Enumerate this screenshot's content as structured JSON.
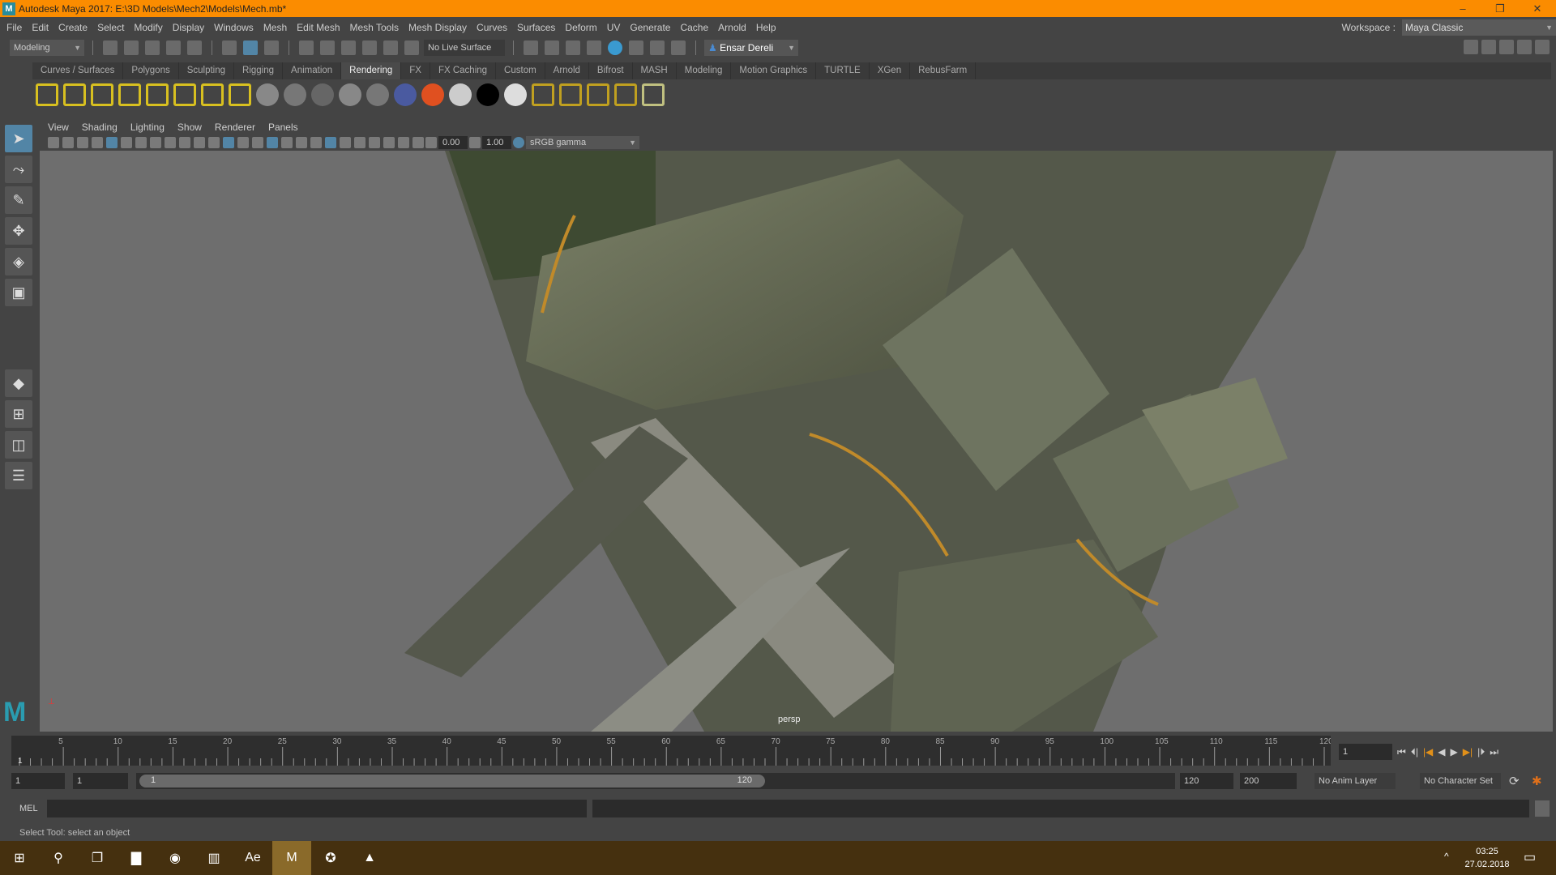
{
  "window": {
    "title": "Autodesk Maya 2017: E:\\3D Models\\Mech2\\Models\\Mech.mb*",
    "logo": "M",
    "minimize": "–",
    "maximize": "❐",
    "close": "✕"
  },
  "menu": [
    "File",
    "Edit",
    "Create",
    "Select",
    "Modify",
    "Display",
    "Windows",
    "Mesh",
    "Edit Mesh",
    "Mesh Tools",
    "Mesh Display",
    "Curves",
    "Surfaces",
    "Deform",
    "UV",
    "Generate",
    "Cache",
    "Arnold",
    "Help"
  ],
  "workspace": {
    "label": "Workspace :",
    "value": "Maya Classic"
  },
  "statusline": {
    "menuset": "Modeling",
    "live_surface": "No Live Surface",
    "user": "Ensar Dereli"
  },
  "shelf": {
    "tabs": [
      "Curves / Surfaces",
      "Polygons",
      "Sculpting",
      "Rigging",
      "Animation",
      "Rendering",
      "FX",
      "FX Caching",
      "Custom",
      "Arnold",
      "Bifrost",
      "MASH",
      "Modeling",
      "Motion Graphics",
      "TURTLE",
      "XGen",
      "RebusFarm"
    ],
    "active": "Rendering",
    "icons": [
      {
        "name": "ambient-light-icon",
        "color": "#d8c020"
      },
      {
        "name": "directional-light-icon",
        "color": "#d8c020"
      },
      {
        "name": "point-light-icon",
        "color": "#d8c020"
      },
      {
        "name": "spot-light-icon",
        "color": "#d8c020"
      },
      {
        "name": "area-light-icon",
        "color": "#d8c020"
      },
      {
        "name": "volume-light-icon",
        "color": "#d8c020"
      },
      {
        "name": "light-editor-icon",
        "color": "#d8c020"
      },
      {
        "name": "hypershade-icon",
        "color": "#d8c020"
      },
      {
        "name": "lambert-sphere-icon",
        "color": "#888888"
      },
      {
        "name": "blinn-sphere-icon",
        "color": "#777777"
      },
      {
        "name": "phong-sphere-icon",
        "color": "#666666"
      },
      {
        "name": "phonge-sphere-icon",
        "color": "#888888"
      },
      {
        "name": "anisotropic-sphere-icon",
        "color": "#777777"
      },
      {
        "name": "ramp-shader-icon",
        "color": "#4a5aa0"
      },
      {
        "name": "heat-map-icon",
        "color": "#e05020"
      },
      {
        "name": "white-sphere-icon",
        "color": "#cccccc"
      },
      {
        "name": "black-sphere-icon",
        "color": "#000000"
      },
      {
        "name": "outlined-sphere-icon",
        "color": "#dddddd"
      },
      {
        "name": "render-view-icon",
        "color": "#c0a020"
      },
      {
        "name": "render-settings-icon",
        "color": "#c0a020"
      },
      {
        "name": "bake-icon",
        "color": "#c0a020"
      },
      {
        "name": "batch-bake-icon",
        "color": "#c0a020"
      },
      {
        "name": "render-layer-icon",
        "color": "#c0c080"
      }
    ]
  },
  "viewport": {
    "menu": [
      "View",
      "Shading",
      "Lighting",
      "Show",
      "Renderer",
      "Panels"
    ],
    "exposure": "0.00",
    "gamma": "1.00",
    "color_space": "sRGB gamma",
    "camera_label": "persp"
  },
  "timeline": {
    "start": 1,
    "end": 120,
    "ticks": [
      5,
      10,
      15,
      20,
      25,
      30,
      35,
      40,
      45,
      50,
      55,
      60,
      65,
      70,
      75,
      80,
      85,
      90,
      95,
      100,
      105,
      110,
      115,
      120
    ],
    "start_label": "1",
    "current_frame": "1"
  },
  "range": {
    "start": "1",
    "playback_start": "1",
    "slider_start": "1",
    "slider_end": "120",
    "playback_end": "120",
    "end": "200",
    "anim_layer": "No Anim Layer",
    "character_set": "No Character Set"
  },
  "command": {
    "lang": "MEL"
  },
  "help_line": "Select Tool: select an object",
  "taskbar": {
    "time": "03:25",
    "date": "27.02.2018",
    "apps": [
      {
        "name": "start-button",
        "g": "⊞"
      },
      {
        "name": "search-button",
        "g": "⚲"
      },
      {
        "name": "task-view-button",
        "g": "❐"
      },
      {
        "name": "file-explorer-app",
        "g": "▇"
      },
      {
        "name": "chrome-app",
        "g": "◉"
      },
      {
        "name": "app-taskbar-3",
        "g": "▥"
      },
      {
        "name": "after-effects-app",
        "g": "Ae"
      },
      {
        "name": "maya-app",
        "g": "M"
      },
      {
        "name": "app-taskbar-9",
        "g": "✪"
      },
      {
        "name": "photos-app",
        "g": "▲"
      }
    ]
  }
}
